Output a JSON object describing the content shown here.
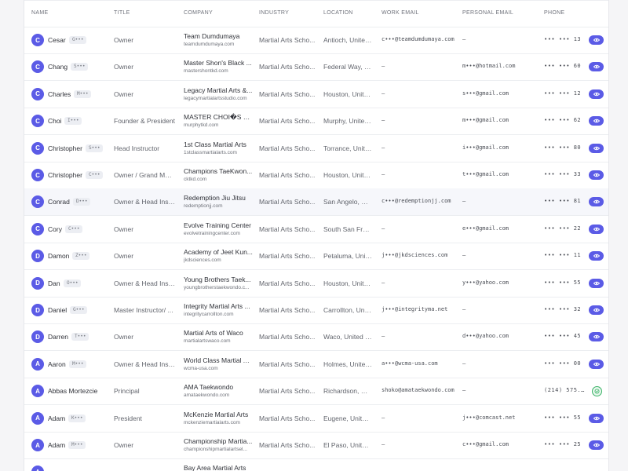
{
  "columns": {
    "name": "NAME",
    "title": "TITLE",
    "company": "COMPANY",
    "industry": "INDUSTRY",
    "location": "LOCATION",
    "work_email": "WORK EMAIL",
    "personal_email": "PERSONAL EMAIL",
    "phone": "PHONE"
  },
  "colors": {
    "accent": "#5b5be6",
    "row_highlight": "#f6f7fb",
    "success": "#38b265"
  },
  "rows": [
    {
      "initial": "C",
      "first": "Cesar",
      "mask": "G•••",
      "title": "Owner",
      "company": "Team Dumdumaya",
      "domain": "teamdumdumaya.com",
      "industry": "Martial Arts Scho...",
      "location": "Antioch, United...",
      "work_email": "c•••@teamdumdumaya.com",
      "personal_email": "–",
      "phone": "••• ••• 13",
      "action_icon": "eye-icon"
    },
    {
      "initial": "C",
      "first": "Chang",
      "mask": "S•••",
      "title": "Owner",
      "company": "Master Shon's Black ...",
      "domain": "mastershontkd.com",
      "industry": "Martial Arts Scho...",
      "location": "Federal Way, U...",
      "work_email": "–",
      "personal_email": "m•••@hotmail.com",
      "phone": "••• ••• 60",
      "action_icon": "eye-icon"
    },
    {
      "initial": "C",
      "first": "Charles",
      "mask": "M•••",
      "title": "Owner",
      "company": "Legacy Martial Arts &...",
      "domain": "legacymartialartsstudio.com",
      "industry": "Martial Arts Scho...",
      "location": "Houston, Unite...",
      "work_email": "–",
      "personal_email": "s•••@gmail.com",
      "phone": "••• ••• 12",
      "action_icon": "eye-icon"
    },
    {
      "initial": "C",
      "first": "Choi",
      "mask": "I•••",
      "title": "Founder & President",
      "company": "MASTER CHOI�S WO...",
      "domain": "murphytkd.com",
      "industry": "Martial Arts Scho...",
      "location": "Murphy, United...",
      "work_email": "–",
      "personal_email": "m•••@gmail.com",
      "phone": "••• ••• 62",
      "action_icon": "eye-icon"
    },
    {
      "initial": "C",
      "first": "Christopher",
      "mask": "S•••",
      "title": "Head Instructor",
      "company": "1st Class Martial Arts",
      "domain": "1stclassmartialarts.com",
      "industry": "Martial Arts Scho...",
      "location": "Torrance, Unite...",
      "work_email": "–",
      "personal_email": "i•••@gmail.com",
      "phone": "••• ••• 80",
      "action_icon": "eye-icon"
    },
    {
      "initial": "C",
      "first": "Christopher",
      "mask": "C•••",
      "title": "Owner / Grand Mas...",
      "company": "Champions TaeKwon...",
      "domain": "cktkd.com",
      "industry": "Martial Arts Scho...",
      "location": "Houston, Unite...",
      "work_email": "–",
      "personal_email": "t•••@gmail.com",
      "phone": "••• ••• 33",
      "action_icon": "eye-icon"
    },
    {
      "initial": "C",
      "first": "Conrad",
      "mask": "D•••",
      "title": "Owner & Head Inst...",
      "company": "Redemption Jiu Jitsu",
      "domain": "redemptionjj.com",
      "industry": "Martial Arts Scho...",
      "location": "San Angelo, Uni...",
      "work_email": "c•••@redemptionjj.com",
      "personal_email": "–",
      "phone": "••• ••• 81",
      "action_icon": "eye-icon",
      "highlight": true
    },
    {
      "initial": "C",
      "first": "Cory",
      "mask": "C•••",
      "title": "Owner",
      "company": "Evolve Training Center",
      "domain": "evolvetrainingcenter.com",
      "industry": "Martial Arts Scho...",
      "location": "South San Fran...",
      "work_email": "–",
      "personal_email": "e•••@gmail.com",
      "phone": "••• ••• 22",
      "action_icon": "eye-icon"
    },
    {
      "initial": "D",
      "first": "Damon",
      "mask": "Z•••",
      "title": "Owner",
      "company": "Academy of Jeet Kun...",
      "domain": "jkdsciences.com",
      "industry": "Martial Arts Scho...",
      "location": "Petaluma, Unit...",
      "work_email": "j•••@jkdsciences.com",
      "personal_email": "–",
      "phone": "••• ••• 11",
      "action_icon": "eye-icon"
    },
    {
      "initial": "D",
      "first": "Dan",
      "mask": "O•••",
      "title": "Owner & Head Inst...",
      "company": "Young Brothers Taek...",
      "domain": "youngbrotherstaekwondo.c...",
      "industry": "Martial Arts Scho...",
      "location": "Houston, Unite...",
      "work_email": "–",
      "personal_email": "y•••@yahoo.com",
      "phone": "••• ••• 55",
      "action_icon": "eye-icon"
    },
    {
      "initial": "D",
      "first": "Daniel",
      "mask": "G•••",
      "title": "Master Instructor/ ...",
      "company": "Integrity Martial Arts ...",
      "domain": "integritycarrollton.com",
      "industry": "Martial Arts Scho...",
      "location": "Carrollton, Unit...",
      "work_email": "j•••@integrityma.net",
      "personal_email": "–",
      "phone": "••• ••• 32",
      "action_icon": "eye-icon"
    },
    {
      "initial": "D",
      "first": "Darren",
      "mask": "T•••",
      "title": "Owner",
      "company": "Martial Arts of Waco",
      "domain": "martialartswaco.com",
      "industry": "Martial Arts Scho...",
      "location": "Waco, United S...",
      "work_email": "–",
      "personal_email": "d•••@yahoo.com",
      "phone": "••• ••• 45",
      "action_icon": "eye-icon"
    },
    {
      "initial": "A",
      "first": "Aaron",
      "mask": "M•••",
      "title": "Owner & Head Inst...",
      "company": "World Class Martial A...",
      "domain": "wcma-usa.com",
      "industry": "Martial Arts Scho...",
      "location": "Holmes, United...",
      "work_email": "a•••@wcma-usa.com",
      "personal_email": "–",
      "phone": "••• ••• 00",
      "action_icon": "eye-icon"
    },
    {
      "initial": "A",
      "first": "Abbas Mortezcie",
      "mask": "",
      "title": "Principal",
      "company": "AMA Taekwondo",
      "domain": "amataekwondo.com",
      "industry": "Martial Arts Scho...",
      "location": "Richardson, Uni...",
      "work_email": "shoko@amataekwondo.com",
      "personal_email": "–",
      "phone": "(214) 575...",
      "action_icon": "check-circle-icon"
    },
    {
      "initial": "A",
      "first": "Adam",
      "mask": "K•••",
      "title": "President",
      "company": "McKenzie Martial Arts",
      "domain": "mckenziemartialarts.com",
      "industry": "Martial Arts Scho...",
      "location": "Eugene, United...",
      "work_email": "–",
      "personal_email": "j•••@comcast.net",
      "phone": "••• ••• 55",
      "action_icon": "eye-icon"
    },
    {
      "initial": "A",
      "first": "Adam",
      "mask": "M•••",
      "title": "Owner",
      "company": "Championship Martia...",
      "domain": "championshipmartialartsel...",
      "industry": "Martial Arts Scho...",
      "location": "El Paso, United ...",
      "work_email": "–",
      "personal_email": "c•••@gmail.com",
      "phone": "••• ••• 25",
      "action_icon": "eye-icon"
    },
    {
      "initial": "A",
      "first": "",
      "mask": "",
      "title": "",
      "company": "Bay Area Martial Arts",
      "domain": "",
      "industry": "",
      "location": "",
      "work_email": "",
      "personal_email": "",
      "phone": "",
      "action_icon": ""
    }
  ]
}
